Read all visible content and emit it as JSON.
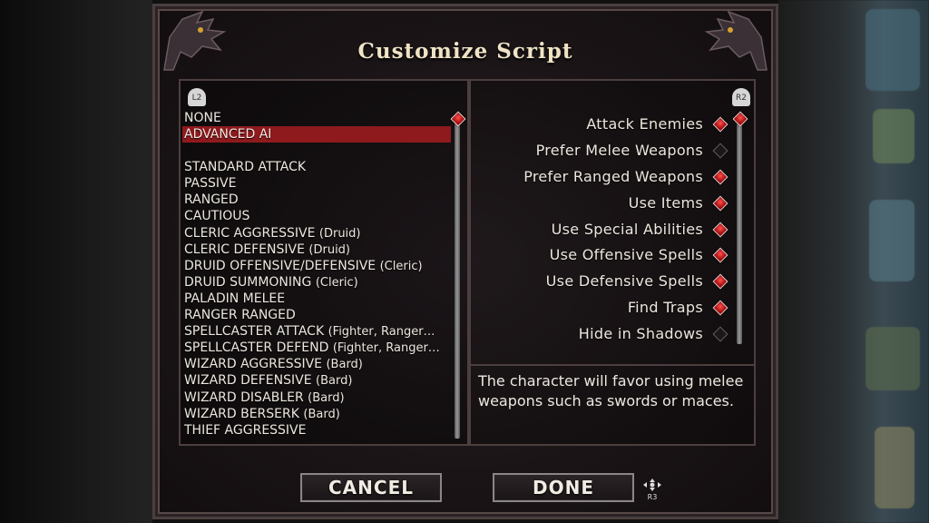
{
  "title": "Customize Script",
  "left_badge": "L2",
  "right_badge": "R2",
  "scripts": [
    {
      "label": "NONE",
      "selected": false
    },
    {
      "label": "ADVANCED AI",
      "selected": true
    },
    {
      "label": "",
      "spacer": true
    },
    {
      "label": "STANDARD ATTACK"
    },
    {
      "label": "PASSIVE"
    },
    {
      "label": "RANGED"
    },
    {
      "label": "CAUTIOUS"
    },
    {
      "label": "CLERIC AGGRESSIVE",
      "sub": "(Druid)"
    },
    {
      "label": "CLERIC DEFENSIVE",
      "sub": "(Druid)"
    },
    {
      "label": "DRUID OFFENSIVE/DEFENSIVE",
      "sub": "(Cleric)"
    },
    {
      "label": "DRUID SUMMONING",
      "sub": "(Cleric)"
    },
    {
      "label": "PALADIN MELEE"
    },
    {
      "label": "RANGER RANGED"
    },
    {
      "label": "SPELLCASTER ATTACK",
      "sub": "(Fighter, Ranger…"
    },
    {
      "label": "SPELLCASTER DEFEND",
      "sub": "(Fighter, Ranger…"
    },
    {
      "label": "WIZARD AGGRESSIVE",
      "sub": "(Bard)"
    },
    {
      "label": "WIZARD DEFENSIVE",
      "sub": "(Bard)"
    },
    {
      "label": "WIZARD DISABLER",
      "sub": "(Bard)"
    },
    {
      "label": "WIZARD BERSERK",
      "sub": "(Bard)"
    },
    {
      "label": "THIEF AGGRESSIVE"
    }
  ],
  "options": [
    {
      "label": "Attack Enemies",
      "checked": true
    },
    {
      "label": "Prefer Melee Weapons",
      "checked": false
    },
    {
      "label": "Prefer Ranged Weapons",
      "checked": true
    },
    {
      "label": "Use Items",
      "checked": true
    },
    {
      "label": "Use Special Abilities",
      "checked": true
    },
    {
      "label": "Use Offensive Spells",
      "checked": true
    },
    {
      "label": "Use Defensive Spells",
      "checked": true
    },
    {
      "label": "Find Traps",
      "checked": true
    },
    {
      "label": "Hide in Shadows",
      "checked": false
    }
  ],
  "description": "The character will favor using melee weapons such as swords or maces.",
  "buttons": {
    "cancel": "CANCEL",
    "done": "DONE"
  },
  "done_badge": "R3",
  "colors": {
    "selected_row": "#8e1a1e",
    "accent_red": "#d11414"
  }
}
